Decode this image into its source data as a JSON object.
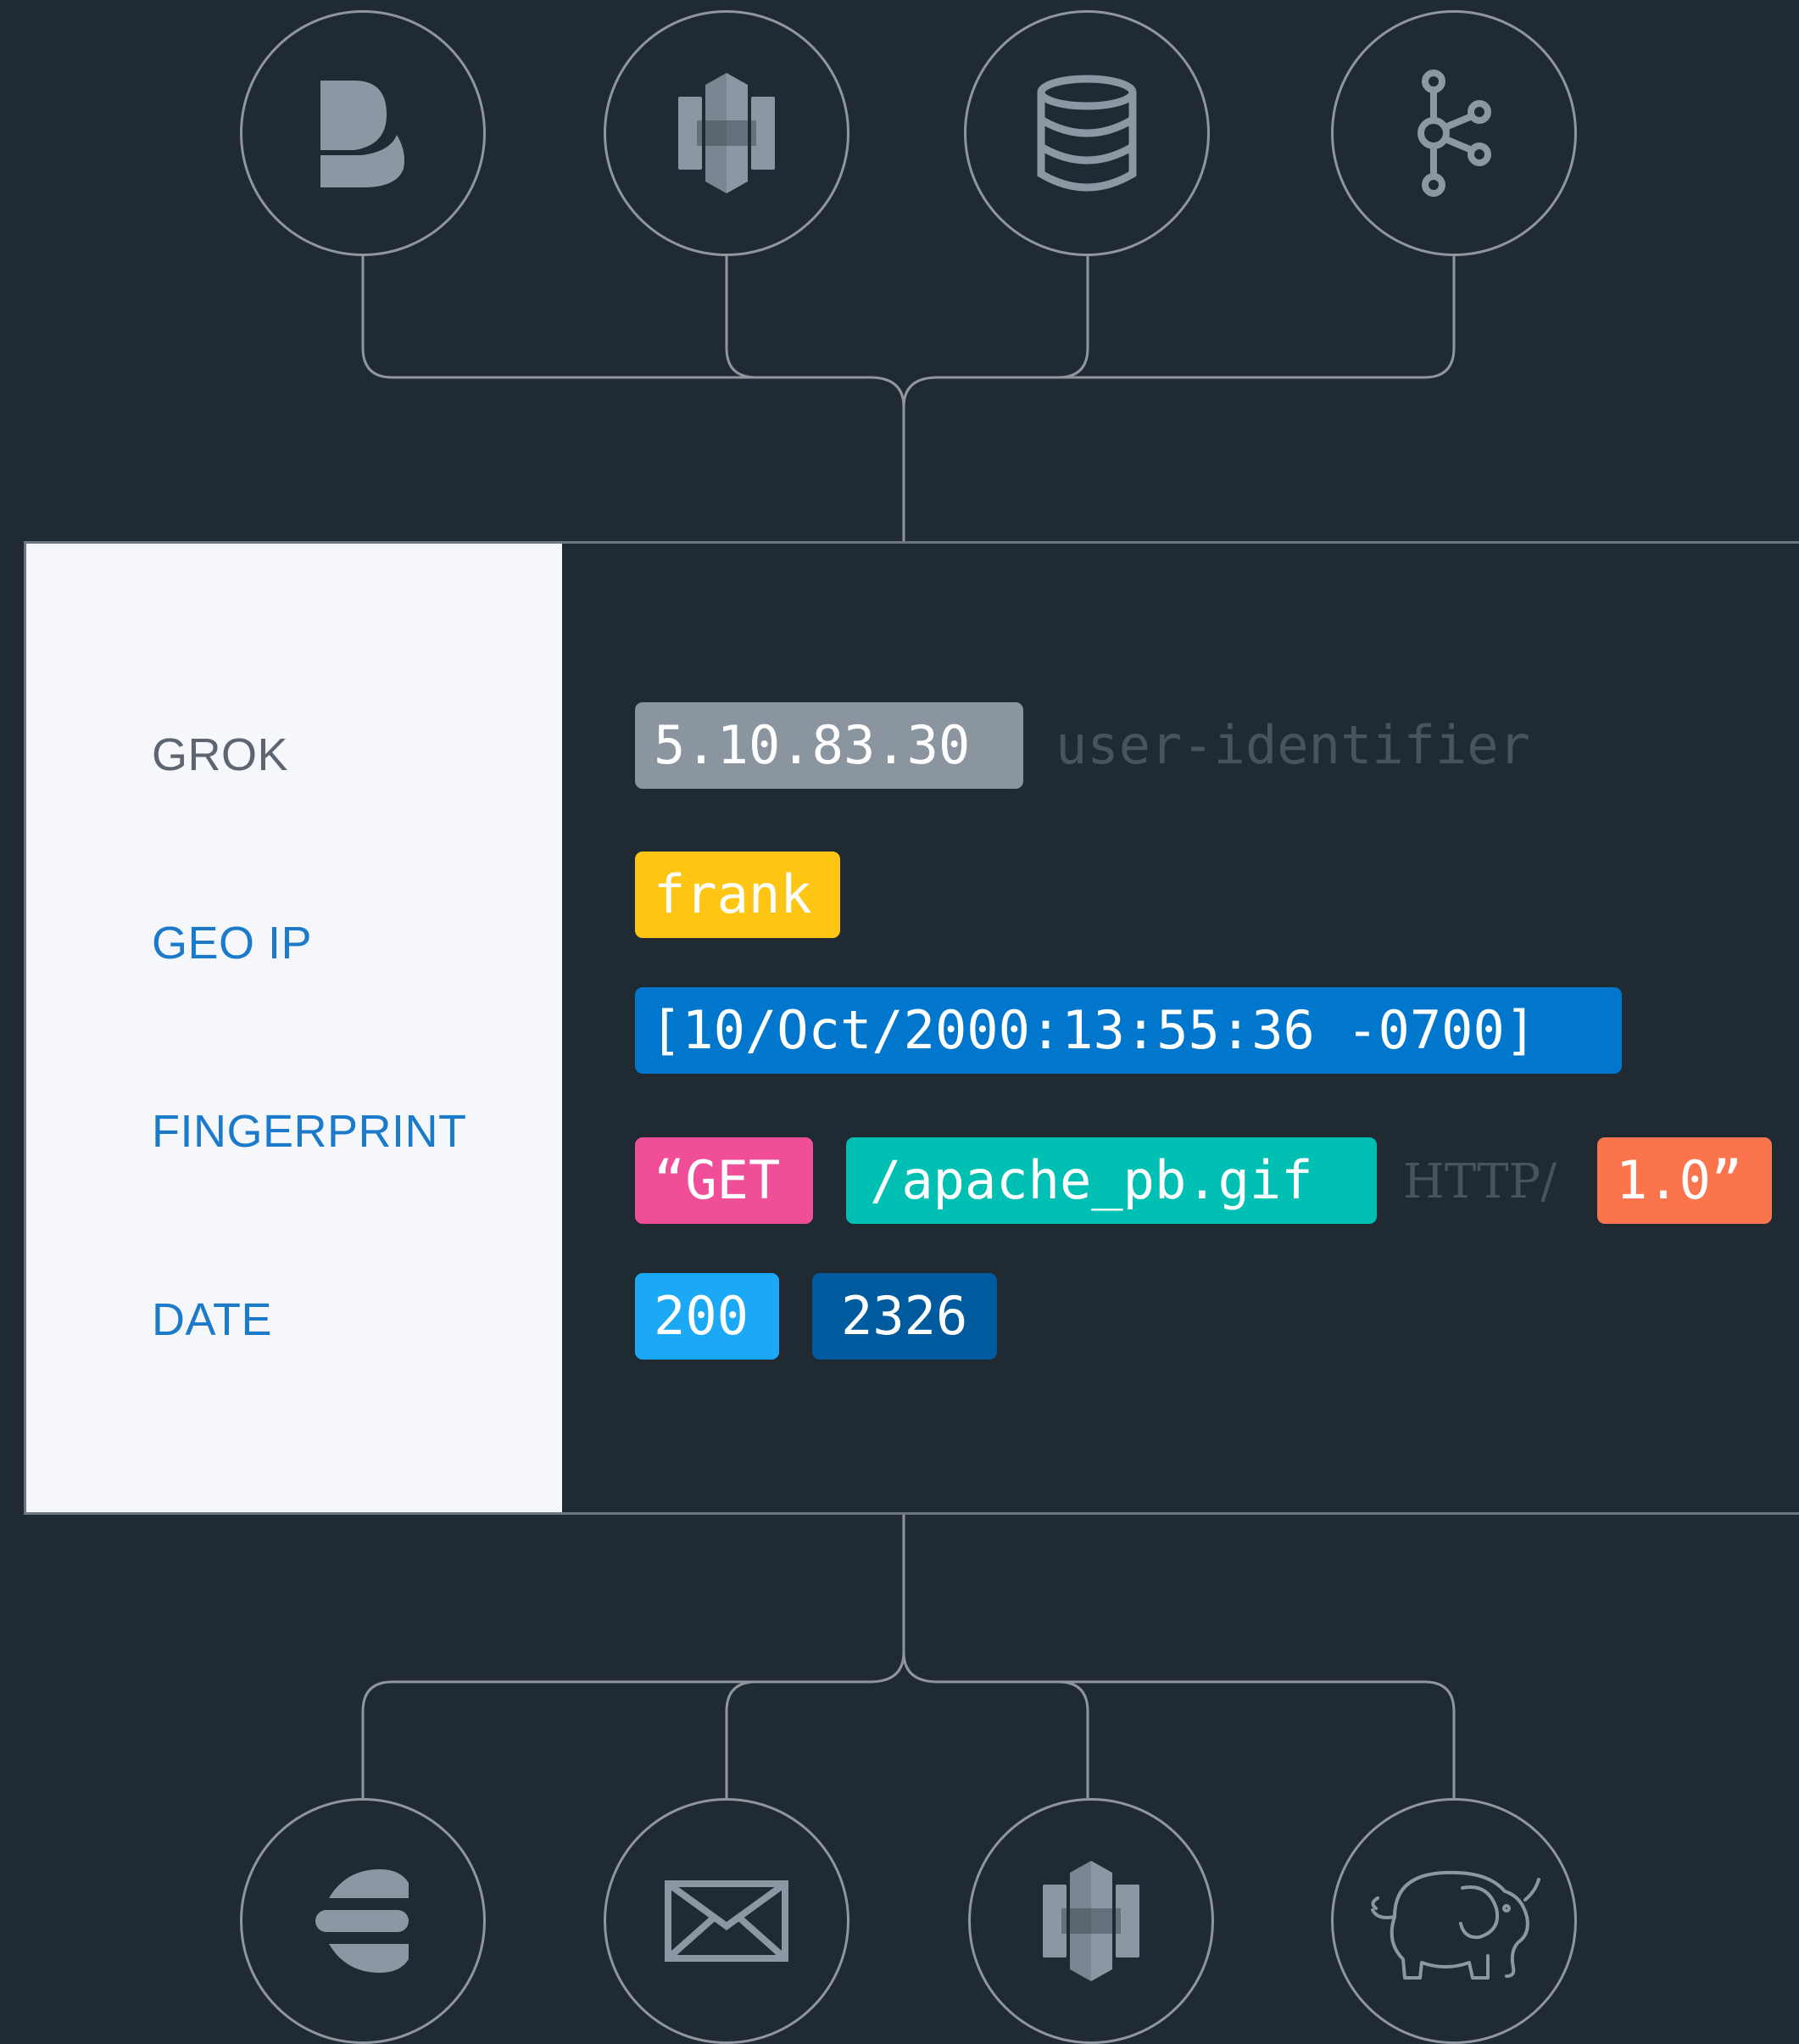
{
  "colors": {
    "background": "#1f2a33",
    "connector": "#8f969d",
    "icon": "#8d96a3",
    "panel_left": "#f5f7fa",
    "label_muted": "#5d6670",
    "label_active": "#1b7ac9"
  },
  "sources": [
    {
      "icon": "beats-icon"
    },
    {
      "icon": "aws-s3-icon"
    },
    {
      "icon": "database-icon"
    },
    {
      "icon": "kafka-icon"
    }
  ],
  "outputs": [
    {
      "icon": "elasticsearch-icon"
    },
    {
      "icon": "email-icon"
    },
    {
      "icon": "aws-s3-icon"
    },
    {
      "icon": "hadoop-elephant-icon"
    }
  ],
  "filters": [
    {
      "label": "GROK",
      "state": "muted"
    },
    {
      "label": "GEO IP",
      "state": "active"
    },
    {
      "label": "FINGERPRINT",
      "state": "active"
    },
    {
      "label": "DATE",
      "state": "active"
    }
  ],
  "log_tokens": {
    "ip": {
      "text": "5.10.83.30",
      "color": "#8b959f"
    },
    "identity": {
      "text": "user-identifier",
      "color": "#48535d"
    },
    "user": {
      "text": "frank",
      "color": "#fec514"
    },
    "timestamp": {
      "text": "[10/Oct/2000:13:55:36 -0700]",
      "color": "#0077cc"
    },
    "method": {
      "text": "“GET",
      "color": "#f04e98"
    },
    "path": {
      "text": "/apache_pb.gif",
      "color": "#00bfb3"
    },
    "protocol": {
      "text": "HTTP/",
      "color": "#48535d"
    },
    "version": {
      "text": "1.0”",
      "color": "#fa744e"
    },
    "status": {
      "text": "200",
      "color": "#1ba9f5"
    },
    "bytes": {
      "text": "2326",
      "color": "#005a9e"
    }
  }
}
